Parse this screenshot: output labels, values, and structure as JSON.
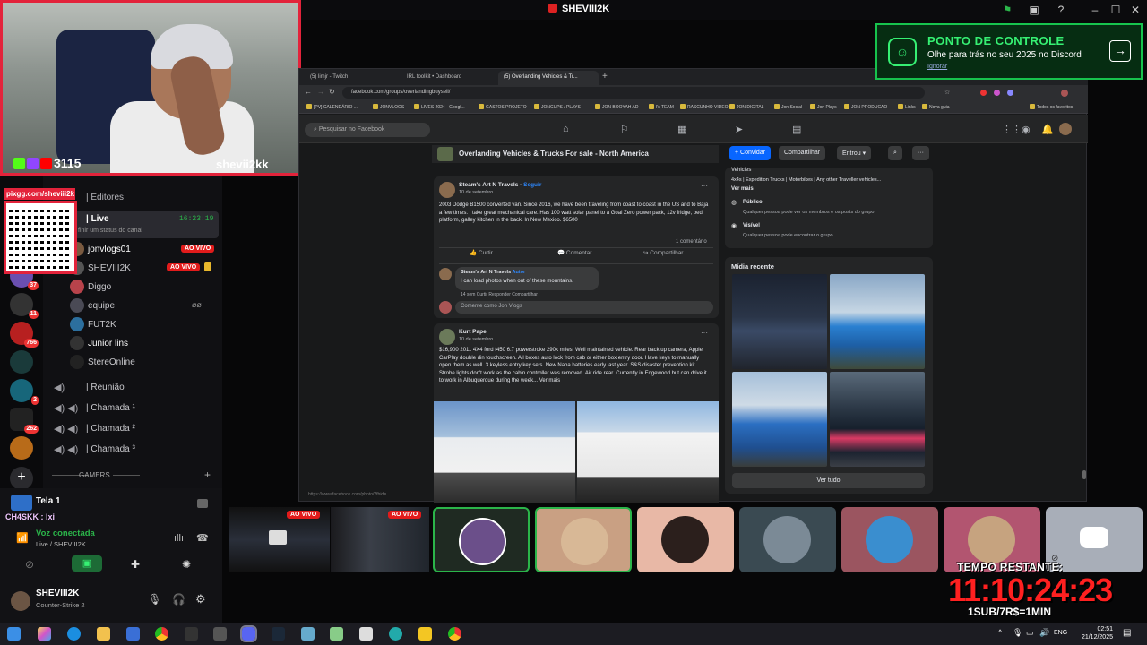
{
  "discord": {
    "window_title": "SHEVIII2K",
    "server_section": "| Editores",
    "live_channel": "| Live",
    "live_time": "16:23:19",
    "status_hint": "finir um status do canal",
    "live_badge": "AO VIVO",
    "channel_users": [
      "jonvlogs01",
      "SHEVIII2K",
      "Diggo",
      "equipe",
      "FUT2K",
      "Junior lins",
      "StereOnline"
    ],
    "voice_channels": [
      "| Reunião",
      "| Chamada ¹",
      "| Chamada ²",
      "| Chamada ³"
    ],
    "gamers_section": "GAMERS",
    "server_badges": [
      "37",
      "11",
      "766",
      "2",
      "262"
    ],
    "stream_title": "Tela 1",
    "chat_line": "CH4SKK : lxi",
    "voice_status": "Voz conectada",
    "voice_channel_detail": "Live / SHEVIII2K",
    "username": "SHEVIII2K",
    "activity": "Counter-Strike 2"
  },
  "cam": {
    "followers": "3115",
    "handle": "shevii2kk",
    "qr_label": "pixgg.com/sheviii2k"
  },
  "promo": {
    "title": "PONTO DE CONTROLE",
    "subtitle": "Olhe para trás no seu 2025 no Discord",
    "link": "Ignorar",
    "arrow": "→"
  },
  "browser": {
    "tabs": [
      "(5) limjr - Twitch",
      "IRL toolkit • Dashboard",
      "(5) Overlanding Vehicles & Tr..."
    ],
    "url": "facebook.com/groups/overlandingbuysell/",
    "bookmarks": [
      "[PV] CALENDÁRIO ...",
      "JONVLOGS",
      "LIVES 2024 - Googl...",
      "GASTOS PROJETO",
      "JONCUPS / PLAYS",
      "JON BOOYAH AD",
      "IV TEAM",
      "RASCUNHO VIDEO",
      "JON DIGITAL",
      "Jon Social",
      "Jon Plays",
      "JON PRODUCAO",
      "Links",
      "Nova guia",
      "Todos os favoritos"
    ],
    "search_placeholder": "Pesquisar no Facebook",
    "group_title": "Overlanding Vehicles & Trucks For sale - North America",
    "btn_invite": "+ Convidar",
    "btn_share": "Compartilhar",
    "btn_joined": "Entrou ▾",
    "post1": {
      "author": "Steam's Art N Travels",
      "follow": "Seguir",
      "date": "10 de setembro",
      "text": "2003 Dodge B1500 converted van. Since 2016, we have been traveling from coast to coast in the US and to Baja a few times. I take great mechanical care. Has 100 watt solar panel to a Goal Zero power pack, 12v fridge, bed platform, galley kitchen in the back. In New Mexico. $6500",
      "comments": "1 comentário",
      "like": "Curtir",
      "comment": "Comentar",
      "share": "Compartilhar",
      "reply_author": "Steam's Art N Travels",
      "reply_tag": "Autor",
      "reply_text": "I can load photos when out of these mountains.",
      "reply_meta": "14 sem   Curtir   Responder   Compartilhar",
      "comment_as": "Comente como Jon Vlogs"
    },
    "post2": {
      "author": "Kurt Pape",
      "date": "10 de setembro",
      "text": "$16,900 2011 4X4 ford f450 6.7 powerstroke 290k miles. Well maintained vehicle. Rear back up camera, Apple CarPlay double din touchscreen. All boxes auto lock from cab or either box entry door. Have keys to manually open them as well. 3 keyless entry key sets. New Napa batteries early last year. S&S disaster prevention kit. Strobe lights don't work as the cabin controller was removed. Air ride rear. Currently in Edgewood but can drive it to work in Albuquerque during the week... Ver mais"
    },
    "about": {
      "vehicles": "Vehicles",
      "tags": "4x4s | Expedition Trucks | Motorbikes | Any other Traveller vehicles...",
      "see_more": "Ver mais",
      "public": "Público",
      "public_desc": "Qualquer pessoa pode ver os membros e os posts do grupo.",
      "visible": "Visível",
      "visible_desc": "Qualquer pessoa pode encontrar o grupo."
    },
    "media_title": "Mídia recente",
    "see_all": "Ver tudo",
    "status_url": "https://www.facebook.com/photo/?fbid=..."
  },
  "timer": {
    "label": "TEMPO RESTANTE:",
    "value": "11:10:24:23",
    "rate": "1SUB/7R$=1MIN"
  },
  "taskbar": {
    "lang": "ENG",
    "time": "02:51",
    "date": "21/12/2025"
  },
  "colors": {
    "accent_red": "#e3233b",
    "discord_green": "#36f073",
    "timer_red": "#ff2020"
  }
}
